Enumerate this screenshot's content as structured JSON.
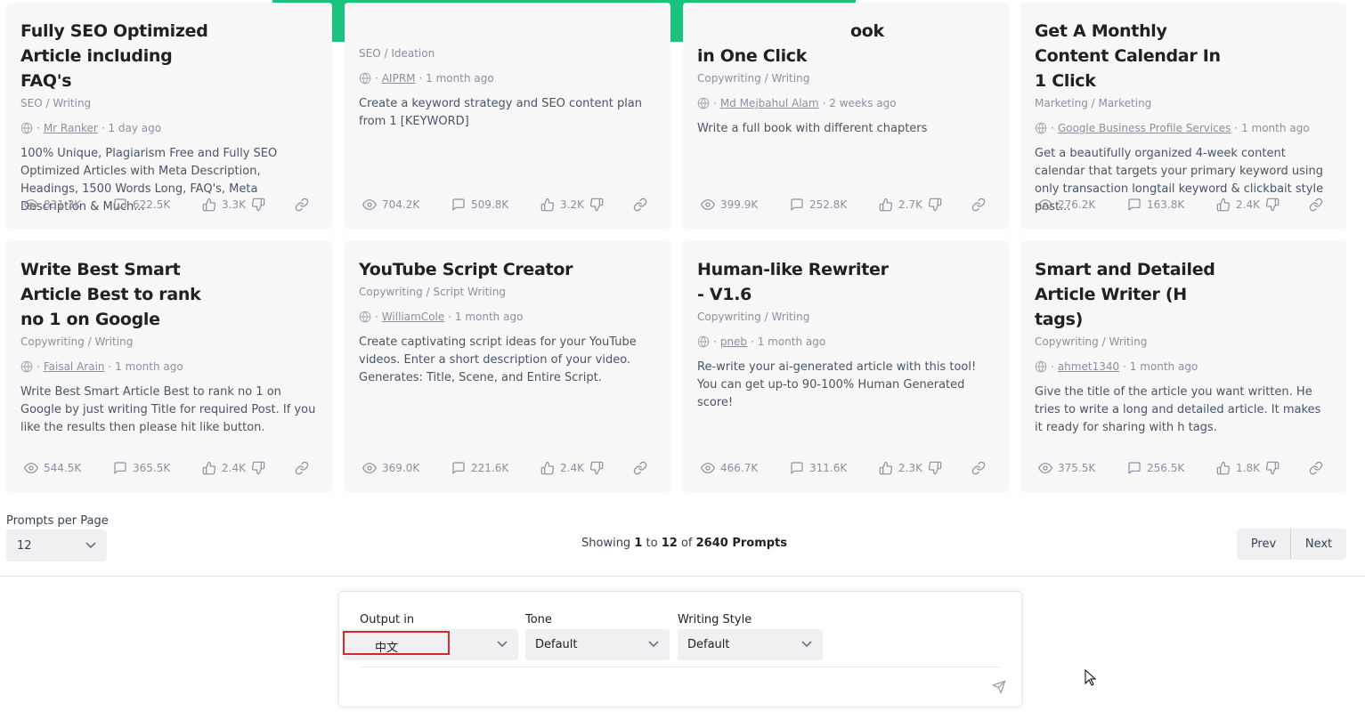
{
  "toast": {
    "color": "#19c37d",
    "like_icon": "thumbs-up-icon",
    "dislike_icon": "thumbs-down-icon"
  },
  "cards": [
    {
      "title": "Fully SEO Optimized Article including FAQ's",
      "category": "SEO / Writing",
      "author": "Mr Ranker",
      "time": "1 day ago",
      "description": "100% Unique, Plagiarism Free and Fully SEO Optimized Articles with Meta Description, Headings, 1500 Words Long, FAQ's, Meta Description & Much...",
      "views": "831.3K",
      "comments": "622.5K",
      "likes": "3.3K"
    },
    {
      "title": "",
      "category": "SEO / Ideation",
      "author": "AIPRM",
      "time": "1 month ago",
      "description": "Create a keyword strategy and SEO content plan from 1 [KEYWORD]",
      "views": "704.2K",
      "comments": "509.8K",
      "likes": "3.2K"
    },
    {
      "title": "in One Click",
      "title_partial": "ook",
      "category": "Copywriting / Writing",
      "author": "Md Mejbahul Alam",
      "time": "2 weeks ago",
      "description": "Write a full book with different chapters",
      "views": "399.9K",
      "comments": "252.8K",
      "likes": "2.7K"
    },
    {
      "title": "Get A Monthly Content Calendar In 1 Click",
      "category": "Marketing / Marketing",
      "author": "Google Business Profile Services",
      "time": "1 month ago",
      "description": "Get a beautifully organized 4-week content calendar that targets your primary keyword using only transaction longtail keyword & clickbait style post...",
      "views": "276.2K",
      "comments": "163.8K",
      "likes": "2.4K"
    },
    {
      "title": "Write Best Smart Article Best to rank no 1 on Google",
      "category": "Copywriting / Writing",
      "author": "Faisal Arain",
      "time": "1 month ago",
      "description": "Write Best Smart Article Best to rank no 1 on Google by just writing Title for required Post. If you like the results then please hit like button.",
      "views": "544.5K",
      "comments": "365.5K",
      "likes": "2.4K"
    },
    {
      "title": "YouTube Script Creator",
      "category": "Copywriting / Script Writing",
      "author": "WilliamCole",
      "time": "1 month ago",
      "description": "Create captivating script ideas for your YouTube videos. Enter a short description of your video. Generates: Title, Scene, and Entire Script.",
      "views": "369.0K",
      "comments": "221.6K",
      "likes": "2.4K"
    },
    {
      "title": "Human-like Rewriter - V1.6",
      "category": "Copywriting / Writing",
      "author": "pneb",
      "time": "1 month ago",
      "description": "Re-write your ai-generated article with this tool! You can get up-to 90-100% Human Generated score!",
      "views": "466.7K",
      "comments": "311.6K",
      "likes": "2.3K"
    },
    {
      "title": "Smart and Detailed Article Writer (H tags)",
      "category": "Copywriting / Writing",
      "author": "ahmet1340",
      "time": "1 month ago",
      "description": "Give the title of the article you want written. He tries to write a long and detailed article. It makes it ready for sharing with h tags.",
      "views": "375.5K",
      "comments": "256.5K",
      "likes": "1.8K"
    }
  ],
  "pagination": {
    "per_page_label": "Prompts per Page",
    "per_page_value": "12",
    "showing_prefix": "Showing",
    "from": "1",
    "to_word": "to",
    "to": "12",
    "of_word": "of",
    "total": "2640 Prompts",
    "prev_label": "Prev",
    "next_label": "Next"
  },
  "composer": {
    "output_label": "Output in",
    "output_value": "中文",
    "tone_label": "Tone",
    "tone_value": "Default",
    "style_label": "Writing Style",
    "style_value": "Default",
    "highlight_color": "#d62828"
  }
}
